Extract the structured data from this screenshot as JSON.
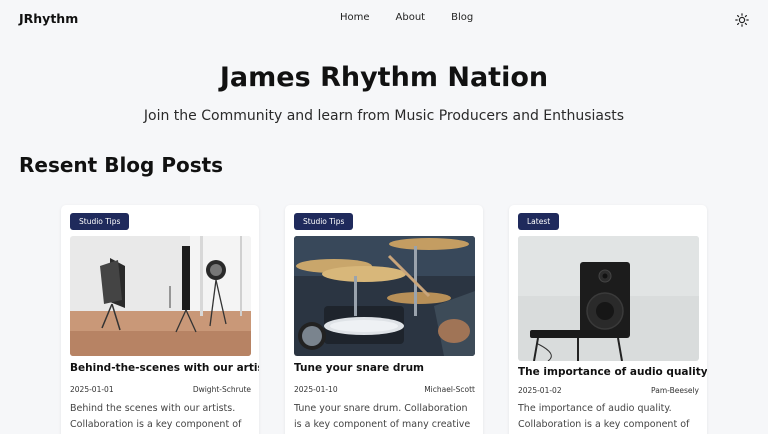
{
  "nav": {
    "brand": "JRhythm",
    "links": [
      "Home",
      "About",
      "Blog"
    ],
    "theme_icon": "sun-icon"
  },
  "hero": {
    "title": "James Rhythm Nation",
    "subtitle": "Join the Community and learn from Music Producers and Enthusiasts"
  },
  "section": {
    "title": "Resent Blog Posts"
  },
  "posts": [
    {
      "badge": "Studio Tips",
      "title": "Behind-the-scenes with our artists",
      "date": "2025-01-01",
      "author": "Dwight-Schrute",
      "excerpt": "Behind the scenes with our artists. Collaboration is a key component of many"
    },
    {
      "badge": "Studio Tips",
      "title": "Tune your snare drum",
      "date": "2025-01-10",
      "author": "Michael-Scott",
      "excerpt": "Tune your snare drum. Collaboration is a key component of many creative"
    },
    {
      "badge": "Latest",
      "title": "The importance of audio quality",
      "date": "2025-01-02",
      "author": "Pam-Beesely",
      "excerpt": "The importance of audio quality. Collaboration is a key component of many"
    }
  ],
  "colors": {
    "background": "#f6f7f9",
    "badge": "#1f2a5c",
    "card": "#ffffff"
  }
}
